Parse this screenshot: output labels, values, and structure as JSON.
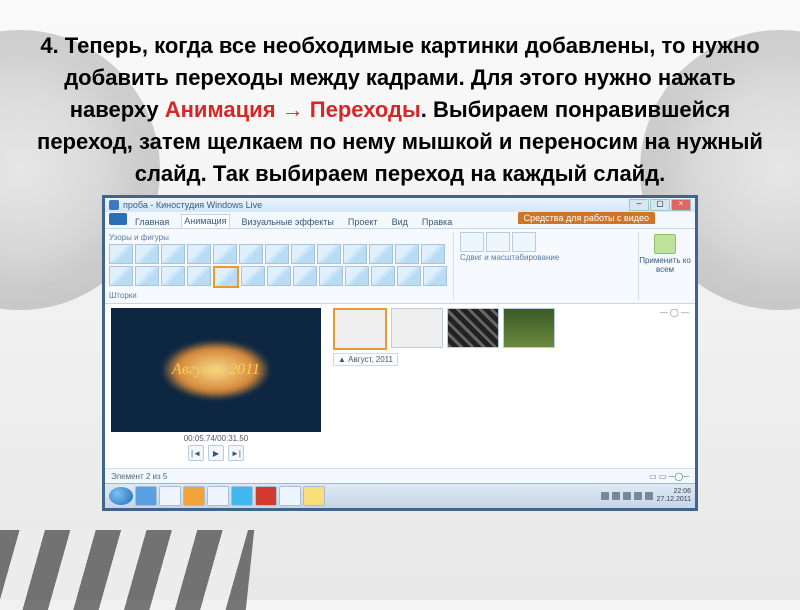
{
  "heading": {
    "p1": "4. Теперь, когда все необходимые картинки добавлены, то нужно добавить переходы между кадрами. Для этого нужно нажать наверху  ",
    "hl1": "Анимация → Переходы",
    "p2": ". Выбираем понравившейся переход, затем щелкаем по нему мышкой и переносим на нужный слайд. Так выбираем переход на каждый слайд."
  },
  "app": {
    "title": "проба - Киностудия Windows Live",
    "context_tab": "Средства для работы с видео",
    "tabs": {
      "home": "Главная",
      "animation": "Анимация",
      "visual": "Визуальные эффекты",
      "project": "Проект",
      "view": "Вид",
      "edit": "Правка"
    },
    "gallery_label1": "Узоры и фигуры",
    "gallery_label2": "Шторки",
    "zoom_label": "Сдвиг и масштабирование",
    "apply_all": "Применить ко всем",
    "preview_text": "Август, 2011",
    "preview_time": "00:05.74/00:31.50",
    "storyboard_label": "▲ Август, 2011",
    "status": "Элемент 2 из 5",
    "clock_time": "22:06",
    "clock_date": "27.12.2011"
  }
}
